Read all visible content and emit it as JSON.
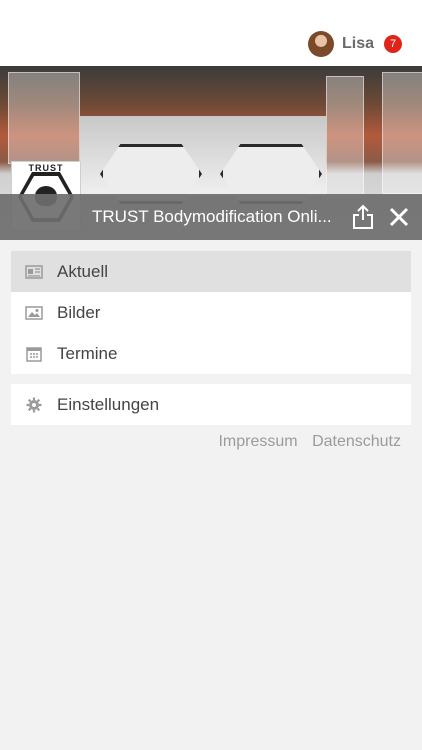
{
  "user": {
    "name": "Lisa",
    "notification_count": "7"
  },
  "app": {
    "title": "TRUST Bodymodification Onli...",
    "logo_text": "TRUST"
  },
  "menu_main": [
    {
      "label": "Aktuell",
      "icon": "newspaper-icon",
      "active": true
    },
    {
      "label": "Bilder",
      "icon": "image-icon",
      "active": false
    },
    {
      "label": "Termine",
      "icon": "calendar-icon",
      "active": false
    }
  ],
  "menu_settings": [
    {
      "label": "Einstellungen",
      "icon": "gear-icon"
    }
  ],
  "footer": {
    "impressum": "Impressum",
    "datenschutz": "Datenschutz"
  },
  "colors": {
    "badge": "#e2231a",
    "titlebar": "#6e6e6e",
    "active_item": "#e0e0e0"
  }
}
